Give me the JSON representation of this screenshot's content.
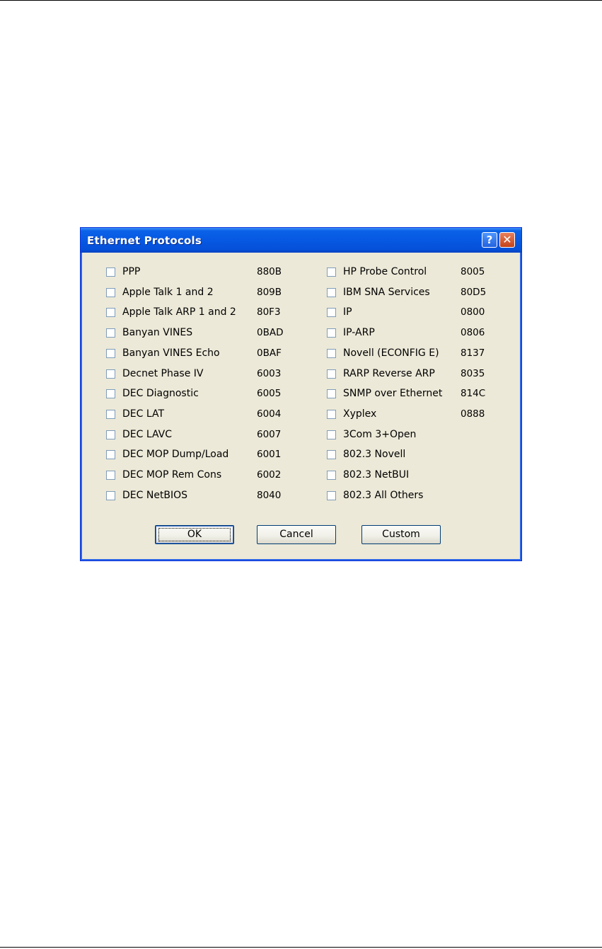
{
  "dialog": {
    "title": "Ethernet Protocols",
    "help_label": "?",
    "close_label": "✕",
    "left_column": [
      {
        "label": "PPP",
        "code": "880B",
        "checked": false
      },
      {
        "label": "Apple Talk 1 and 2",
        "code": "809B",
        "checked": false
      },
      {
        "label": "Apple Talk ARP 1 and 2",
        "code": "80F3",
        "checked": false
      },
      {
        "label": "Banyan VINES",
        "code": "0BAD",
        "checked": false
      },
      {
        "label": "Banyan VINES Echo",
        "code": "0BAF",
        "checked": false
      },
      {
        "label": "Decnet Phase IV",
        "code": "6003",
        "checked": false
      },
      {
        "label": "DEC Diagnostic",
        "code": "6005",
        "checked": false
      },
      {
        "label": "DEC LAT",
        "code": "6004",
        "checked": false
      },
      {
        "label": "DEC LAVC",
        "code": "6007",
        "checked": false
      },
      {
        "label": "DEC MOP Dump/Load",
        "code": "6001",
        "checked": false
      },
      {
        "label": "DEC MOP Rem Cons",
        "code": "6002",
        "checked": false
      },
      {
        "label": "DEC NetBIOS",
        "code": "8040",
        "checked": false
      }
    ],
    "right_column": [
      {
        "label": "HP Probe Control",
        "code": "8005",
        "checked": false
      },
      {
        "label": "IBM SNA Services",
        "code": "80D5",
        "checked": false
      },
      {
        "label": "IP",
        "code": "0800",
        "checked": false
      },
      {
        "label": "IP-ARP",
        "code": "0806",
        "checked": false
      },
      {
        "label": "Novell (ECONFIG E)",
        "code": "8137",
        "checked": false
      },
      {
        "label": "RARP Reverse ARP",
        "code": "8035",
        "checked": false
      },
      {
        "label": "SNMP over Ethernet",
        "code": "814C",
        "checked": false
      },
      {
        "label": "Xyplex",
        "code": "0888",
        "checked": false
      },
      {
        "label": "3Com 3+Open",
        "code": "",
        "checked": false
      },
      {
        "label": "802.3 Novell",
        "code": "",
        "checked": false
      },
      {
        "label": "802.3 NetBUI",
        "code": "",
        "checked": false
      },
      {
        "label": "802.3 All Others",
        "code": "",
        "checked": false
      }
    ],
    "buttons": {
      "ok": "OK",
      "cancel": "Cancel",
      "custom": "Custom"
    }
  }
}
